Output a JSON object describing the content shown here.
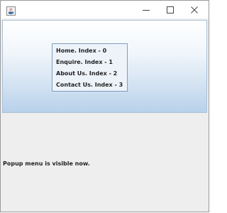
{
  "window": {
    "icons": {
      "app": "java-app-icon",
      "minimize": "minimize-icon",
      "maximize": "maximize-icon",
      "close": "close-icon"
    }
  },
  "popup_menu": {
    "items": [
      {
        "label": "Home. Index - 0"
      },
      {
        "label": "Enquire. Index - 1"
      },
      {
        "label": "About Us. Index - 2"
      },
      {
        "label": "Contact Us. Index - 3"
      }
    ]
  },
  "status": {
    "text": "Popup menu is visible now."
  },
  "colors": {
    "panel_gradient_top": "#ffffff",
    "panel_gradient_bottom": "#b8d1ea",
    "panel_border": "#a9bfd6",
    "popup_border": "#7f9db9",
    "window_background": "#eeeeee"
  }
}
